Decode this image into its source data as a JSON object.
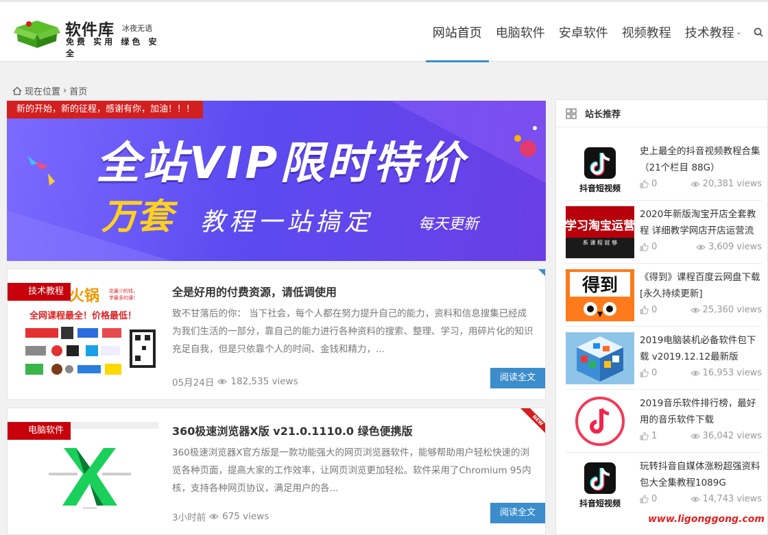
{
  "site": {
    "name": "软件库",
    "sub": "冰夜无语",
    "tags": "免费 实用 绿色 安全"
  },
  "nav": {
    "items": [
      {
        "label": "网站首页"
      },
      {
        "label": "电脑软件"
      },
      {
        "label": "安卓软件"
      },
      {
        "label": "视频教程"
      },
      {
        "label": "技术教程"
      }
    ]
  },
  "breadcrumb": {
    "current": "现在位置",
    "sep": "›",
    "page": "首页"
  },
  "banner": {
    "notice": "新的开始，新的征程，感谢有你，加油！！！",
    "headline": "全站VIP限时特价",
    "wan": "万套",
    "rest": "教程一站搞定",
    "daily": "每天更新"
  },
  "posts": [
    {
      "category": "技术教程",
      "title": "全是好用的付费资源，请低调使用",
      "excerpt": "致不甘落后的你： 当下社会，每个人都在努力提升自己的能力，资料和信息搜集已经成为我们生活的一部分，靠自己的能力进行各种资料的搜索、整理、学习，用碎片化的知识充足自我，但是只依靠个人的时间、金钱和精力，...",
      "date": "05月24日",
      "views": "182,535 views",
      "read": "阅读全文",
      "thumb": {
        "brand": "火锅",
        "slogan": "全网课程最全！价格最低！",
        "tip": "花最少的钱，学最多的课！"
      }
    },
    {
      "category": "电脑软件",
      "title": "360极速浏览器X版 v21.0.1110.0 绿色便携版",
      "excerpt": "360极速浏览器X官方版是一款功能强大的网页浏览器软件，能够帮助用户轻松快速的浏览各种页面，提高大家的工作效率，让网页浏览更加轻松。软件采用了Chromium 95内核，支持各种网页协议，满足用户的各...",
      "date": "3小时前",
      "views": "675 views",
      "read": "阅读全文",
      "badge": "NEW"
    }
  ],
  "sidebar": {
    "title": "站长推荐",
    "items": [
      {
        "title": "史上最全的抖音视频教程合集（21个栏目 88G）",
        "likes": "0",
        "views": "20,381 views",
        "img_text": "抖音短视频"
      },
      {
        "title": "2020年新版淘宝开店全套教程 详细教学网店开店运营流",
        "likes": "0",
        "views": "3,609 views",
        "img_text": "学习淘宝运营",
        "img_sub": "系 课 程 就 够"
      },
      {
        "title": "《得到》课程百度云网盘下载[永久持续更新]",
        "likes": "0",
        "views": "25,360 views",
        "img_text": "得到"
      },
      {
        "title": "2019电脑装机必备软件包下载 v2019.12.12最新版",
        "likes": "0",
        "views": "16,953 views"
      },
      {
        "title": "2019音乐软件排行榜，最好用的音乐软件下载",
        "likes": "1",
        "views": "36,042 views"
      },
      {
        "title": "玩转抖音自媒体涨粉超强资料包大全集教程1089G",
        "likes": "0",
        "views": "14,743 views",
        "img_text": "抖音短视频"
      }
    ]
  },
  "watermark": "www.ligonggong.com",
  "colors": {
    "accent": "#3b8dcc",
    "red": "#c7000b",
    "green": "#3aa83a"
  }
}
